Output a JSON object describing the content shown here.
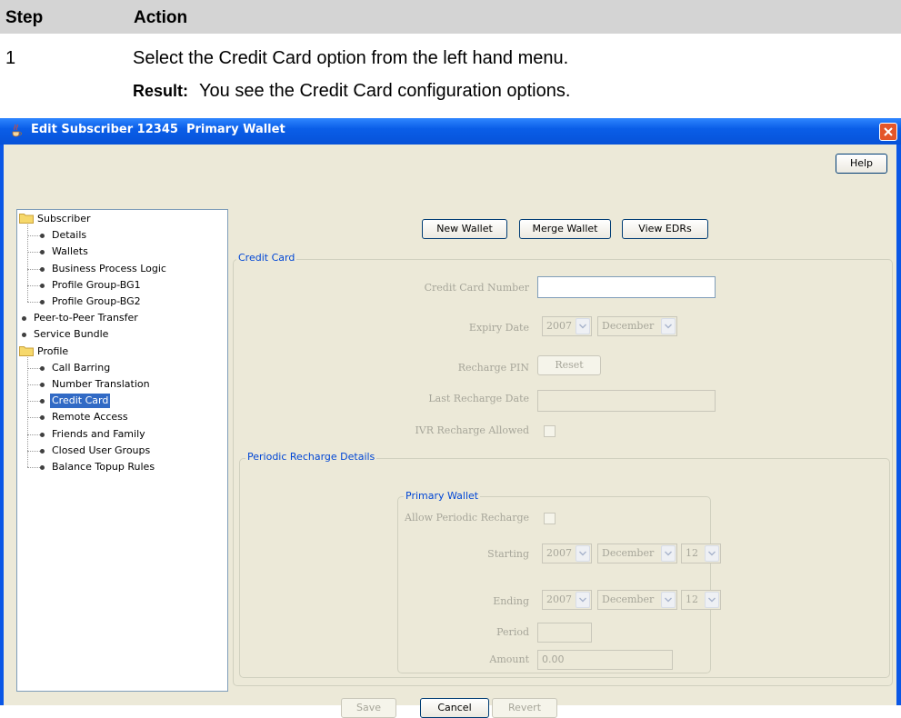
{
  "doc": {
    "header_step": "Step",
    "header_action": "Action",
    "step_number": "1",
    "step_text": "Select the Credit Card option from the left hand menu.",
    "result_label": "Result:",
    "result_text": "You see the Credit Card configuration options."
  },
  "window": {
    "title": "Edit Subscriber 12345  Primary Wallet",
    "title_color": "#0a57e6",
    "help_label": "Help"
  },
  "tree": {
    "items": [
      {
        "label": "Subscriber",
        "type": "folder"
      },
      {
        "label": "Details",
        "type": "leaf"
      },
      {
        "label": "Wallets",
        "type": "leaf"
      },
      {
        "label": "Business Process Logic",
        "type": "leaf"
      },
      {
        "label": "Profile Group-BG1",
        "type": "leaf"
      },
      {
        "label": "Profile Group-BG2",
        "type": "leaf"
      },
      {
        "label": "Peer-to-Peer Transfer",
        "type": "root-leaf"
      },
      {
        "label": "Service Bundle",
        "type": "root-leaf"
      },
      {
        "label": "Profile",
        "type": "folder"
      },
      {
        "label": "Call Barring",
        "type": "leaf"
      },
      {
        "label": "Number Translation",
        "type": "leaf"
      },
      {
        "label": "Credit Card",
        "type": "leaf",
        "selected": true
      },
      {
        "label": "Remote Access",
        "type": "leaf"
      },
      {
        "label": "Friends and Family",
        "type": "leaf"
      },
      {
        "label": "Closed User Groups",
        "type": "leaf"
      },
      {
        "label": "Balance Topup Rules",
        "type": "leaf"
      }
    ],
    "selected_color": "#316ac5"
  },
  "toolbar": {
    "new_wallet": "New Wallet",
    "merge_wallet": "Merge Wallet",
    "view_edrs": "View EDRs"
  },
  "credit_card": {
    "legend": "Credit Card",
    "number_label": "Credit Card Number",
    "number_value": "",
    "expiry_label": "Expiry Date",
    "expiry_year": "2007",
    "expiry_month": "December",
    "pin_label": "Recharge PIN",
    "reset_label": "Reset",
    "last_recharge_label": "Last Recharge Date",
    "last_recharge_value": "",
    "ivr_label": "IVR Recharge Allowed"
  },
  "periodic": {
    "legend": "Periodic Recharge Details",
    "wallet_legend": "Primary Wallet",
    "allow_label": "Allow Periodic Recharge",
    "starting_label": "Starting",
    "starting_year": "2007",
    "starting_month": "December",
    "starting_day": "12",
    "ending_label": "Ending",
    "ending_year": "2007",
    "ending_month": "December",
    "ending_day": "12",
    "period_label": "Period",
    "period_value": "",
    "amount_label": "Amount",
    "amount_value": "0.00"
  },
  "footer": {
    "save": "Save",
    "cancel": "Cancel",
    "revert": "Revert"
  }
}
